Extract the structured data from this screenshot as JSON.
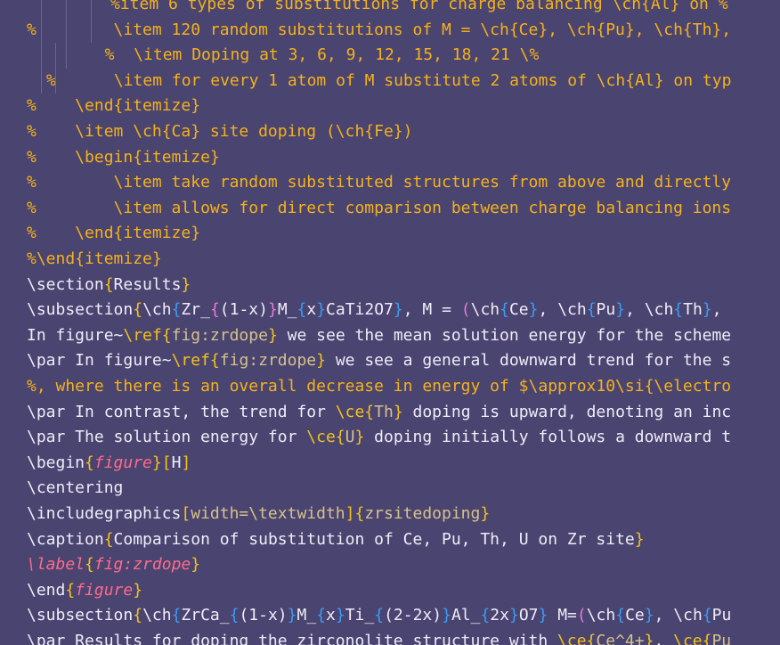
{
  "editor": {
    "lines": [
      [
        {
          "t": "%item 6 types of substitutions for charge balancing \\ch{Al} on %",
          "c": "comment"
        }
      ],
      [
        {
          "t": "%        \\item 120 random substitutions of M = \\ch{Ce}, \\ch{Pu}, \\ch{Th},",
          "c": "comment"
        }
      ],
      [
        {
          "t": "  %  \\item Doping at 3, 6, 9, 12, 15, 18, 21 \\%",
          "c": "comment"
        }
      ],
      [
        {
          "t": "%      \\item for every 1 atom of M substitute 2 atoms of \\ch{Al} on typ",
          "c": "comment"
        }
      ],
      [
        {
          "t": "%    \\end{itemize}",
          "c": "comment"
        }
      ],
      [
        {
          "t": "%    \\item \\ch{Ca} site doping (\\ch{Fe})",
          "c": "comment"
        }
      ],
      [
        {
          "t": "%    \\begin{itemize}",
          "c": "comment"
        }
      ],
      [
        {
          "t": "%        \\item take random substituted structures from above and directly",
          "c": "comment"
        }
      ],
      [
        {
          "t": "%        \\item allows for direct comparison between charge balancing ions",
          "c": "comment"
        }
      ],
      [
        {
          "t": "%    \\end{itemize}",
          "c": "comment"
        }
      ],
      [
        {
          "t": "%\\end{itemize}",
          "c": "comment"
        }
      ],
      [
        {
          "t": "\\section",
          "c": "keyword"
        },
        {
          "t": "{",
          "c": "brace-y"
        },
        {
          "t": "Results",
          "c": "default"
        },
        {
          "t": "}",
          "c": "brace-y"
        }
      ],
      [
        {
          "t": "\\subsection",
          "c": "keyword"
        },
        {
          "t": "{",
          "c": "brace-y"
        },
        {
          "t": "\\ch",
          "c": "keyword"
        },
        {
          "t": "{",
          "c": "brace-b"
        },
        {
          "t": "Zr_",
          "c": "default"
        },
        {
          "t": "{",
          "c": "brace-p"
        },
        {
          "t": "(1-x)",
          "c": "default"
        },
        {
          "t": "}",
          "c": "brace-p"
        },
        {
          "t": "M_",
          "c": "default"
        },
        {
          "t": "{",
          "c": "brace-b"
        },
        {
          "t": "x",
          "c": "default"
        },
        {
          "t": "}",
          "c": "brace-b"
        },
        {
          "t": "CaTi2O7",
          "c": "default"
        },
        {
          "t": "}",
          "c": "brace-b"
        },
        {
          "t": ", M = ",
          "c": "default"
        },
        {
          "t": "(",
          "c": "brace-p"
        },
        {
          "t": "\\ch",
          "c": "keyword"
        },
        {
          "t": "{",
          "c": "brace-b"
        },
        {
          "t": "Ce",
          "c": "default"
        },
        {
          "t": "}",
          "c": "brace-b"
        },
        {
          "t": ", ",
          "c": "default"
        },
        {
          "t": "\\ch",
          "c": "keyword"
        },
        {
          "t": "{",
          "c": "brace-b"
        },
        {
          "t": "Pu",
          "c": "default"
        },
        {
          "t": "}",
          "c": "brace-b"
        },
        {
          "t": ", ",
          "c": "default"
        },
        {
          "t": "\\ch",
          "c": "keyword"
        },
        {
          "t": "{",
          "c": "brace-b"
        },
        {
          "t": "Th",
          "c": "default"
        },
        {
          "t": "}",
          "c": "brace-b"
        },
        {
          "t": ",",
          "c": "default"
        }
      ],
      [
        {
          "t": "In figure~",
          "c": "default"
        },
        {
          "t": "\\ref",
          "c": "ref"
        },
        {
          "t": "{",
          "c": "brace-y"
        },
        {
          "t": "fig:zrdope",
          "c": "refarg"
        },
        {
          "t": "}",
          "c": "brace-y"
        },
        {
          "t": " we see the mean solution energy for the scheme",
          "c": "default"
        }
      ],
      [
        {
          "t": "\\par In figure~",
          "c": "default"
        },
        {
          "t": "\\ref",
          "c": "ref"
        },
        {
          "t": "{",
          "c": "brace-y"
        },
        {
          "t": "fig:zrdope",
          "c": "refarg"
        },
        {
          "t": "}",
          "c": "brace-y"
        },
        {
          "t": " we see a general downward trend for the s",
          "c": "default"
        }
      ],
      [
        {
          "t": "%, where there is an overall decrease in energy of $\\approx10\\si{\\electro",
          "c": "comment"
        }
      ],
      [
        {
          "t": "\\par In contrast, the trend for ",
          "c": "default"
        },
        {
          "t": "\\ce",
          "c": "ref"
        },
        {
          "t": "{",
          "c": "brace-y"
        },
        {
          "t": "Th",
          "c": "refarg"
        },
        {
          "t": "}",
          "c": "brace-y"
        },
        {
          "t": " doping is upward, denoting an inc",
          "c": "default"
        }
      ],
      [
        {
          "t": "\\par The solution energy for ",
          "c": "default"
        },
        {
          "t": "\\ce",
          "c": "ref"
        },
        {
          "t": "{",
          "c": "brace-y"
        },
        {
          "t": "U",
          "c": "refarg"
        },
        {
          "t": "}",
          "c": "brace-y"
        },
        {
          "t": " doping initially follows a downward t",
          "c": "default"
        }
      ],
      [
        {
          "t": "\\begin",
          "c": "keyword"
        },
        {
          "t": "{",
          "c": "brace-y"
        },
        {
          "t": "figure",
          "c": "italic"
        },
        {
          "t": "}",
          "c": "brace-y"
        },
        {
          "t": "[",
          "c": "brace-y"
        },
        {
          "t": "H",
          "c": "default"
        },
        {
          "t": "]",
          "c": "brace-y"
        }
      ],
      [
        {
          "t": "\\centering",
          "c": "keyword"
        }
      ],
      [
        {
          "t": "\\includegraphics",
          "c": "keyword"
        },
        {
          "t": "[",
          "c": "brace-y"
        },
        {
          "t": "width=\\textwidth",
          "c": "refarg"
        },
        {
          "t": "]",
          "c": "brace-y"
        },
        {
          "t": "{",
          "c": "brace-y"
        },
        {
          "t": "zrsitedoping",
          "c": "refarg"
        },
        {
          "t": "}",
          "c": "brace-y"
        }
      ],
      [
        {
          "t": "\\caption",
          "c": "keyword"
        },
        {
          "t": "{",
          "c": "brace-y"
        },
        {
          "t": "Comparison of substitution of Ce, Pu, Th, U on Zr site",
          "c": "default"
        },
        {
          "t": "}",
          "c": "brace-y"
        }
      ],
      [
        {
          "t": "\\label",
          "c": "italic"
        },
        {
          "t": "{",
          "c": "brace-y"
        },
        {
          "t": "fig:zrdope",
          "c": "italic"
        },
        {
          "t": "}",
          "c": "brace-y"
        }
      ],
      [
        {
          "t": "\\end",
          "c": "keyword"
        },
        {
          "t": "{",
          "c": "brace-y"
        },
        {
          "t": "figure",
          "c": "italic"
        },
        {
          "t": "}",
          "c": "brace-y"
        }
      ],
      [
        {
          "t": "\\subsection",
          "c": "keyword"
        },
        {
          "t": "{",
          "c": "brace-y"
        },
        {
          "t": "\\ch",
          "c": "keyword"
        },
        {
          "t": "{",
          "c": "brace-b"
        },
        {
          "t": "ZrCa_",
          "c": "default"
        },
        {
          "t": "{",
          "c": "brace-b"
        },
        {
          "t": "(1-x)",
          "c": "default"
        },
        {
          "t": "}",
          "c": "brace-b"
        },
        {
          "t": "M_",
          "c": "default"
        },
        {
          "t": "{",
          "c": "brace-b"
        },
        {
          "t": "x",
          "c": "default"
        },
        {
          "t": "}",
          "c": "brace-b"
        },
        {
          "t": "Ti_",
          "c": "default"
        },
        {
          "t": "{",
          "c": "brace-b"
        },
        {
          "t": "(2-2x)",
          "c": "default"
        },
        {
          "t": "}",
          "c": "brace-b"
        },
        {
          "t": "Al_",
          "c": "default"
        },
        {
          "t": "{",
          "c": "brace-b"
        },
        {
          "t": "2x",
          "c": "default"
        },
        {
          "t": "}",
          "c": "brace-b"
        },
        {
          "t": "O7",
          "c": "default"
        },
        {
          "t": "}",
          "c": "brace-b"
        },
        {
          "t": " M=",
          "c": "default"
        },
        {
          "t": "(",
          "c": "brace-p"
        },
        {
          "t": "\\ch",
          "c": "keyword"
        },
        {
          "t": "{",
          "c": "brace-b"
        },
        {
          "t": "Ce",
          "c": "default"
        },
        {
          "t": "}",
          "c": "brace-b"
        },
        {
          "t": ", ",
          "c": "default"
        },
        {
          "t": "\\ch",
          "c": "keyword"
        },
        {
          "t": "{",
          "c": "brace-b"
        },
        {
          "t": "Pu",
          "c": "default"
        }
      ],
      [
        {
          "t": "\\par Results for doping the zirconolite structure with ",
          "c": "default"
        },
        {
          "t": "\\ce",
          "c": "ref"
        },
        {
          "t": "{",
          "c": "brace-y"
        },
        {
          "t": "Ce^4+",
          "c": "refarg"
        },
        {
          "t": "}",
          "c": "brace-y"
        },
        {
          "t": ", ",
          "c": "default"
        },
        {
          "t": "\\ce",
          "c": "ref"
        },
        {
          "t": "{",
          "c": "brace-y"
        },
        {
          "t": "Pu",
          "c": "refarg"
        }
      ]
    ]
  },
  "colors": {
    "background": "#4a4470",
    "comment": "#f5b21a",
    "default": "#f0ecf8"
  }
}
